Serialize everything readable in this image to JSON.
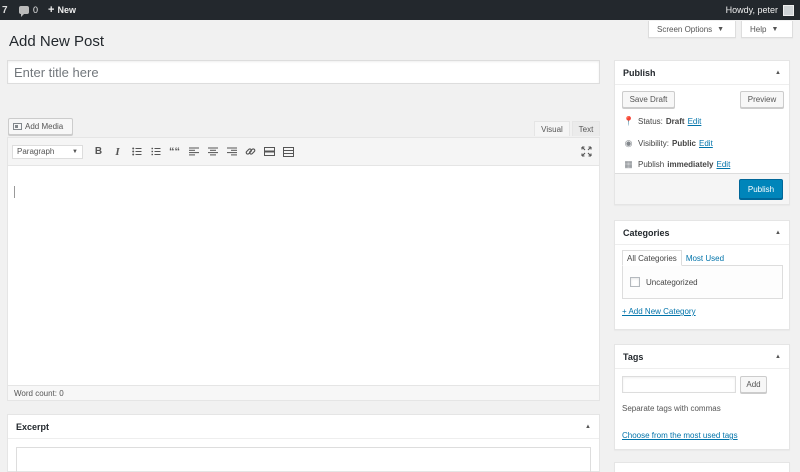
{
  "admin_bar": {
    "comment_count": "0",
    "new_label": "New",
    "howdy": "Howdy, peter"
  },
  "screen_meta": {
    "screen_options": "Screen Options",
    "help": "Help"
  },
  "page": {
    "title": "Add New Post",
    "title_placeholder": "Enter title here"
  },
  "editor": {
    "add_media": "Add Media",
    "tab_visual": "Visual",
    "tab_text": "Text",
    "format_select": "Paragraph",
    "toolbar": {
      "bold": "B",
      "italic": "I",
      "blockquote": "““"
    },
    "word_count": "Word count: 0"
  },
  "excerpt": {
    "title": "Excerpt"
  },
  "publish": {
    "title": "Publish",
    "save_draft": "Save Draft",
    "preview": "Preview",
    "status_label": "Status:",
    "status_value": "Draft",
    "visibility_label": "Visibility:",
    "visibility_value": "Public",
    "publish_label": "Publish",
    "publish_value": "immediately",
    "edit": "Edit",
    "publish_button": "Publish"
  },
  "categories": {
    "title": "Categories",
    "tab_all": "All Categories",
    "tab_most_used": "Most Used",
    "items": [
      {
        "label": "Uncategorized",
        "checked": false
      }
    ],
    "add_new": "+ Add New Category"
  },
  "tags": {
    "title": "Tags",
    "add_button": "Add",
    "hint": "Separate tags with commas",
    "choose_link": "Choose from the most used tags"
  },
  "colors": {
    "admin_bar": "#23282d",
    "primary": "#0085ba",
    "link": "#0073aa"
  }
}
